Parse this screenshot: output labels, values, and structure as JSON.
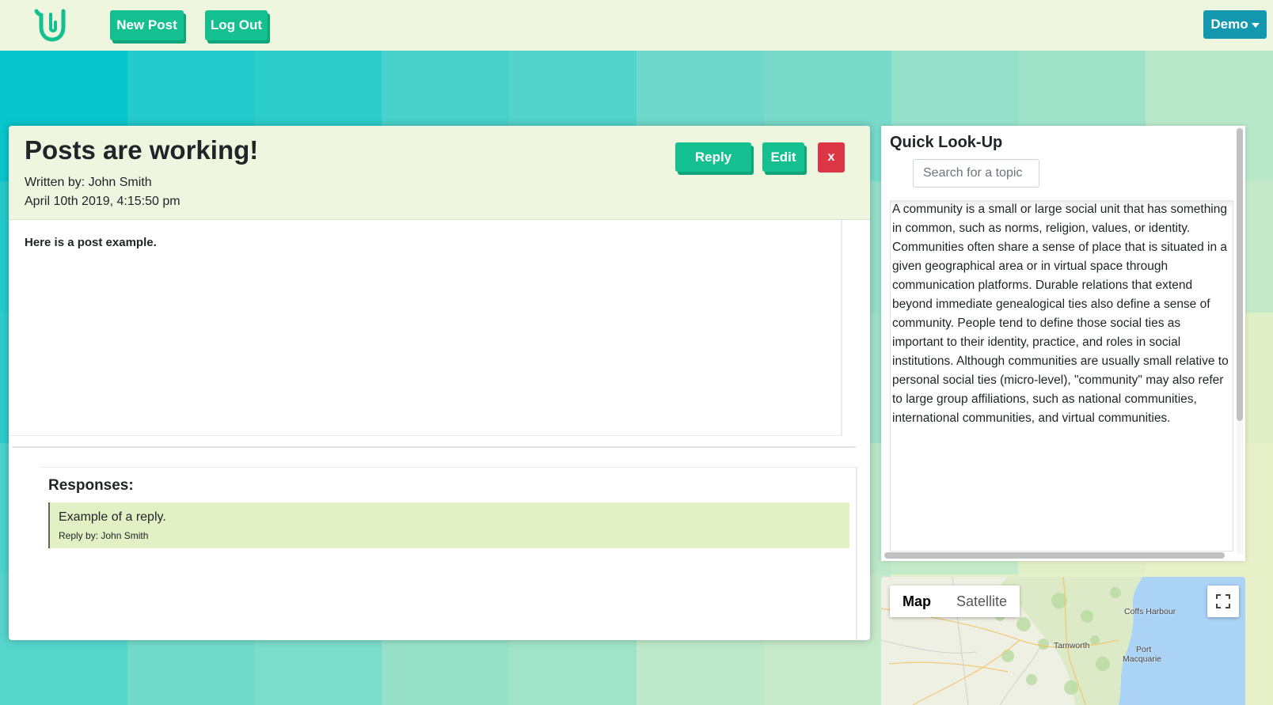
{
  "colors": {
    "accent": "#14c08f",
    "accent_shadow": "#0ea57a",
    "navbar_bg": "#eef6df",
    "danger": "#dc3545",
    "demo_btn": "#1498b0",
    "reply_bg": "#e3f0c3"
  },
  "navbar": {
    "logo_icon": "u-logo-icon",
    "new_post_label": "New Post",
    "log_out_label": "Log Out",
    "user_menu_label": "Demo"
  },
  "post": {
    "title": "Posts are working!",
    "author_line": "Written by: John Smith",
    "date_line": "April 10th 2019, 4:15:50 pm",
    "reply_label": "Reply",
    "edit_label": "Edit",
    "delete_label": "x",
    "body": "Here is a post example."
  },
  "responses": {
    "title": "Responses:",
    "items": [
      {
        "text": "Example of a reply.",
        "by": "Reply by: John Smith"
      }
    ]
  },
  "lookup": {
    "title": "Quick Look-Up",
    "search_placeholder": "Search for a topic",
    "search_value": "",
    "text": "A community is a small or large social unit that has something in common, such as norms, religion, values, or identity. Communities often share a sense of place that is situated in a given geographical area or in virtual space through communication platforms. Durable relations that extend beyond immediate genealogical ties also define a sense of community. People tend to define those social ties as important to their identity, practice, and roles in social institutions. Although communities are usually small relative to personal social ties (micro-level), \"community\" may also refer to large group affiliations, such as national communities, international communities, and virtual communities."
  },
  "map": {
    "tab_map": "Map",
    "tab_satellite": "Satellite",
    "fullscreen_icon": "fullscreen-icon",
    "places": {
      "coffs": "Coffs Harbour",
      "tamworth": "Tamworth",
      "port": "Port",
      "macquarie": "Macquarie"
    }
  }
}
